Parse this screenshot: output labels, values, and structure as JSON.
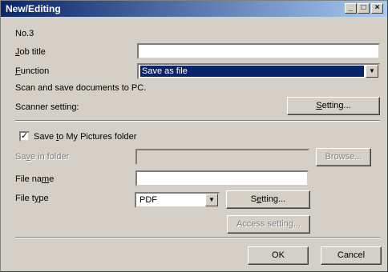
{
  "window": {
    "title": "New/Editing"
  },
  "number": "No.3",
  "job_title": {
    "label": "Job title",
    "value": ""
  },
  "function": {
    "label": "Function",
    "value": "Save as file"
  },
  "description": "Scan and save documents to PC.",
  "scanner": {
    "label": "Scanner setting:",
    "button": "Setting..."
  },
  "save_pictures": {
    "label": "Save to My Pictures folder",
    "checked": true
  },
  "save_folder": {
    "label": "Save in folder",
    "value": "",
    "button": "Browse..."
  },
  "file_name": {
    "label": "File name",
    "value": ""
  },
  "file_type": {
    "label": "File type",
    "value": "PDF",
    "button": "Setting..."
  },
  "access_button": "Access setting...",
  "ok_button": "OK",
  "cancel_button": "Cancel"
}
